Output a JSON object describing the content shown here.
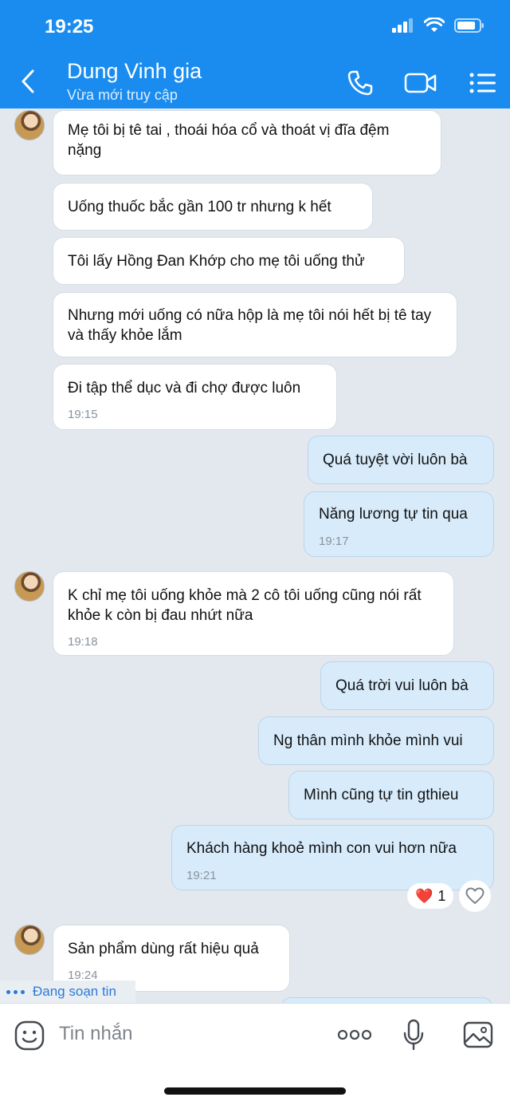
{
  "status": {
    "time": "19:25"
  },
  "header": {
    "contact_name": "Dung Vinh gia",
    "presence": "Vừa mới truy cập"
  },
  "messages": [
    {
      "dir": "in",
      "text": "Mẹ tôi bị tê tai , thoái hóa cổ và thoát vị đĩa đệm nặng",
      "time": null
    },
    {
      "dir": "in",
      "text": "Uống thuốc bắc gần 100 tr nhưng k hết",
      "time": null
    },
    {
      "dir": "in",
      "text": "Tôi lấy Hồng Đan Khớp cho mẹ tôi uống thử",
      "time": null
    },
    {
      "dir": "in",
      "text": "Nhưng mới uống có nữa hộp là mẹ tôi nói hết bị tê tay và thấy khỏe lắm",
      "time": null
    },
    {
      "dir": "in",
      "text": "Đi tập thể dục và đi chợ được luôn",
      "time": "19:15"
    },
    {
      "dir": "out",
      "text": "Quá tuyệt vời luôn bà",
      "time": null
    },
    {
      "dir": "out",
      "text": "Năng lương tự tin qua",
      "time": "19:17"
    },
    {
      "dir": "in",
      "text": "K chỉ mẹ tôi uống khỏe mà 2 cô tôi uống cũng nói rất khỏe k còn bị đau nhứt nữa",
      "time": "19:18"
    },
    {
      "dir": "out",
      "text": "Quá trời vui luôn bà",
      "time": null
    },
    {
      "dir": "out",
      "text": "Ng thân mình khỏe mình vui",
      "time": null
    },
    {
      "dir": "out",
      "text": "Mình cũng tự tin gthieu",
      "time": null
    },
    {
      "dir": "out",
      "text": "Khách hàng khoẻ mình con vui hơn nữa",
      "time": "19:21"
    },
    {
      "dir": "in",
      "text": "Sản phẩm dùng rất hiệu quả",
      "time": "19:24"
    }
  ],
  "reaction": {
    "emoji": "❤️",
    "count": "1"
  },
  "typing_indicator": "Đang soạn tin",
  "composer": {
    "placeholder": "Tin nhắn"
  },
  "colors": {
    "header": "#1a8cf0",
    "background": "#e2e8ee",
    "outgoing_bubble": "#d7ebfb",
    "incoming_bubble": "#ffffff",
    "typing_text": "#2c7ad6"
  },
  "icons": [
    "back-chevron-icon",
    "phone-icon",
    "video-call-icon",
    "menu-list-icon",
    "heart-outline-icon",
    "emoji-icon",
    "more-icon",
    "microphone-icon",
    "image-icon"
  ]
}
